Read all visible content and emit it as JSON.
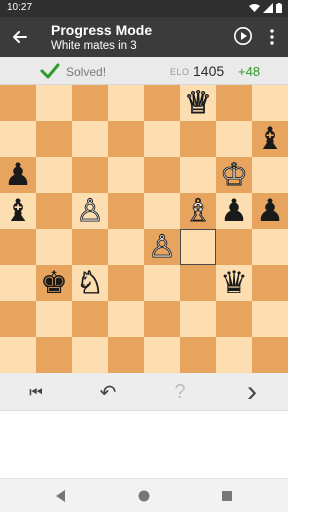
{
  "status_bar": {
    "time": "10:27",
    "icons": [
      "wifi-icon",
      "signal-icon",
      "battery-icon"
    ]
  },
  "app_bar": {
    "title": "Progress Mode",
    "subtitle": "White mates in 3",
    "icons": [
      "back-arrow-icon",
      "play-circle-icon",
      "more-vert-icon"
    ]
  },
  "info": {
    "solved_label": "Solved!",
    "elo_label": "ELO",
    "elo_value": "1405",
    "elo_delta": "+48",
    "colors": {
      "check": "#2e9c2a",
      "delta": "#2e9c2a"
    }
  },
  "board": {
    "colors": {
      "light": "#fddeb0",
      "dark": "#e7a45e"
    },
    "highlight_square": "f4",
    "pieces": [
      {
        "square": "f8",
        "piece": "queen",
        "color": "white",
        "glyph": "♕"
      },
      {
        "square": "h7",
        "piece": "bishop",
        "color": "black",
        "glyph": "♝"
      },
      {
        "square": "a6",
        "piece": "pawn",
        "color": "black",
        "glyph": "♟"
      },
      {
        "square": "g6",
        "piece": "king",
        "color": "white",
        "glyph": "♔"
      },
      {
        "square": "a5",
        "piece": "bishop",
        "color": "black",
        "glyph": "♝"
      },
      {
        "square": "c5",
        "piece": "pawn",
        "color": "white",
        "glyph": "♙"
      },
      {
        "square": "f5",
        "piece": "bishop",
        "color": "white",
        "glyph": "♗"
      },
      {
        "square": "g5",
        "piece": "pawn",
        "color": "black",
        "glyph": "♟"
      },
      {
        "square": "h5",
        "piece": "pawn",
        "color": "black",
        "glyph": "♟"
      },
      {
        "square": "e4",
        "piece": "pawn",
        "color": "white",
        "glyph": "♙"
      },
      {
        "square": "b3",
        "piece": "king",
        "color": "black",
        "glyph": "♚"
      },
      {
        "square": "c3",
        "piece": "knight",
        "color": "white",
        "glyph": "♘"
      },
      {
        "square": "g3",
        "piece": "queen",
        "color": "black",
        "glyph": "♛"
      }
    ]
  },
  "controls": [
    {
      "name": "first-move-button",
      "icon": "skip-back-icon",
      "glyph": "⏮",
      "enabled": true
    },
    {
      "name": "undo-button",
      "icon": "undo-icon",
      "glyph": "↶",
      "enabled": true
    },
    {
      "name": "hint-button",
      "icon": "question-icon",
      "glyph": "?",
      "enabled": false
    },
    {
      "name": "next-button",
      "icon": "chevron-right-icon",
      "glyph": "›",
      "enabled": true
    }
  ],
  "nav_bar": {
    "icons": [
      "nav-back-icon",
      "nav-home-icon",
      "nav-recents-icon"
    ]
  }
}
